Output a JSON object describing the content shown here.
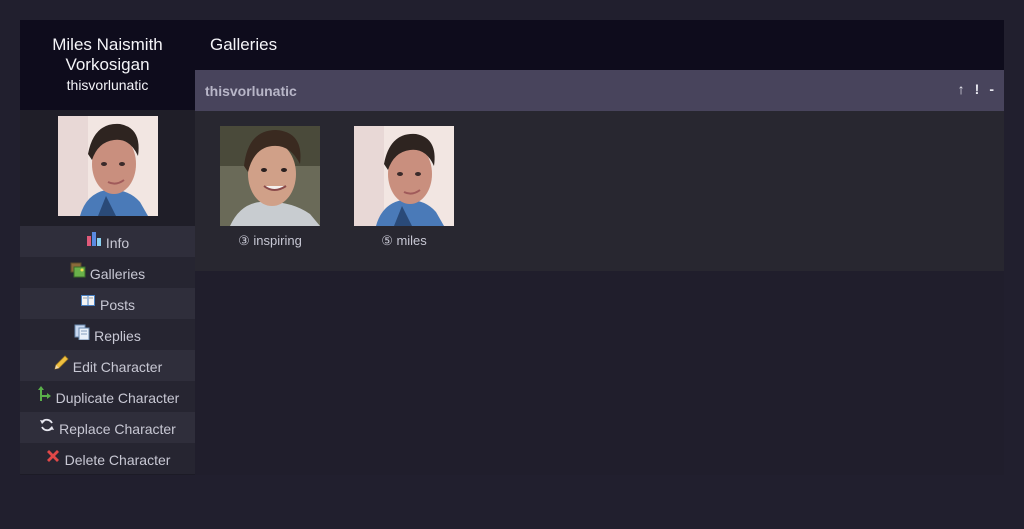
{
  "character": {
    "name": "Miles Naismith Vorkosigan",
    "screenname": "thisvorlunatic"
  },
  "nav": [
    {
      "label": "Info",
      "icon": "chart-icon"
    },
    {
      "label": "Galleries",
      "icon": "pictures-icon"
    },
    {
      "label": "Posts",
      "icon": "book-icon"
    },
    {
      "label": "Replies",
      "icon": "pages-icon"
    },
    {
      "label": "Edit Character",
      "icon": "pencil-icon"
    },
    {
      "label": "Duplicate Character",
      "icon": "split-arrow-icon"
    },
    {
      "label": "Replace Character",
      "icon": "swap-arrows-icon"
    },
    {
      "label": "Delete Character",
      "icon": "red-x-icon"
    }
  ],
  "main": {
    "title": "Galleries",
    "gallery": {
      "name": "thisvorlunatic",
      "actions": [
        "↑",
        "!",
        "-"
      ],
      "icons": [
        {
          "caption": "③ inspiring"
        },
        {
          "caption": "⑤ miles"
        }
      ]
    }
  },
  "colors": {
    "header_bg": "#0e0c1c",
    "subheader_bg": "#48445c",
    "page_bg": "#211f2e",
    "delete_red": "#e04040"
  }
}
